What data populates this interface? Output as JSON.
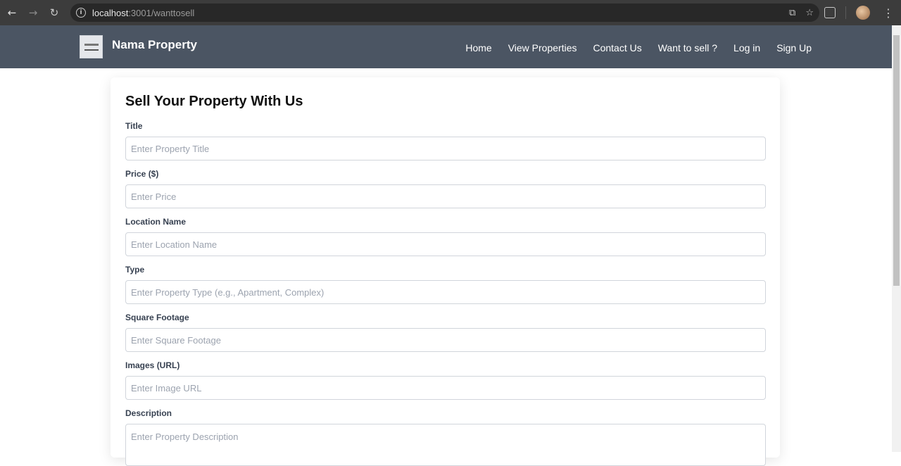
{
  "browser": {
    "back_icon": "←",
    "forward_icon": "→",
    "reload_icon": "↻",
    "url_host": "localhost",
    "url_path": ":3001/wanttosell",
    "install_icon": "⧉",
    "star_icon": "☆",
    "menu_icon": "⋮"
  },
  "header": {
    "brand": "Nama Property",
    "nav": [
      "Home",
      "View Properties",
      "Contact Us",
      "Want to sell ?",
      "Log in",
      "Sign Up"
    ]
  },
  "form": {
    "title": "Sell Your Property With Us",
    "fields": [
      {
        "label": "Title",
        "placeholder": "Enter Property Title"
      },
      {
        "label": "Price ($)",
        "placeholder": "Enter Price"
      },
      {
        "label": "Location Name",
        "placeholder": "Enter Location Name"
      },
      {
        "label": "Type",
        "placeholder": "Enter Property Type (e.g., Apartment, Complex)"
      },
      {
        "label": "Square Footage",
        "placeholder": "Enter Square Footage"
      },
      {
        "label": "Images (URL)",
        "placeholder": "Enter Image URL"
      },
      {
        "label": "Description",
        "placeholder": "Enter Property Description"
      }
    ]
  },
  "colors": {
    "header_bg": "#4b5563",
    "chrome_bg": "#3c3c3c"
  }
}
